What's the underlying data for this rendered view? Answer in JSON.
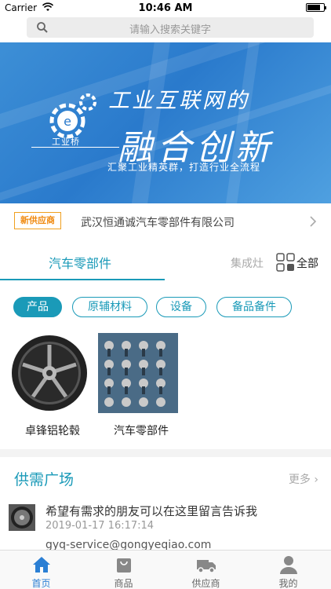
{
  "status": {
    "carrier": "Carrier",
    "time": "10:46 AM"
  },
  "search": {
    "placeholder": "请输入搜索关键字"
  },
  "banner": {
    "line1": "工业互联网的",
    "line2": "融合创新",
    "subtitle": "汇聚工业精英群，打造行业全流程",
    "logo_text": "工业桥"
  },
  "ticker": {
    "badge": "新供应商",
    "text": "武汉恒通诚汽车零部件有限公司"
  },
  "tabs": {
    "active": "汽车零部件",
    "second": "集成灶",
    "all": "全部"
  },
  "chips": [
    {
      "label": "产品",
      "active": true
    },
    {
      "label": "原辅材料",
      "active": false
    },
    {
      "label": "设备",
      "active": false
    },
    {
      "label": "备品备件",
      "active": false
    }
  ],
  "products": [
    {
      "name": "卓锋铝轮毂"
    },
    {
      "name": "汽车零部件"
    }
  ],
  "supply_demand": {
    "title": "供需广场",
    "more": "更多",
    "item": {
      "message": "希望有需求的朋友可以在这里留言告诉我",
      "time": "2019-01-17 16:17:14",
      "email": "gyq-service@gongyeqiao.com"
    }
  },
  "tabbar": [
    {
      "label": "首页",
      "icon": "home-icon",
      "active": true
    },
    {
      "label": "商品",
      "icon": "bag-icon",
      "active": false
    },
    {
      "label": "供应商",
      "icon": "truck-icon",
      "active": false
    },
    {
      "label": "我的",
      "icon": "person-icon",
      "active": false
    }
  ],
  "colors": {
    "accent": "#1a9ab8",
    "tab_active": "#2b7fd4",
    "badge": "#f08a10"
  }
}
